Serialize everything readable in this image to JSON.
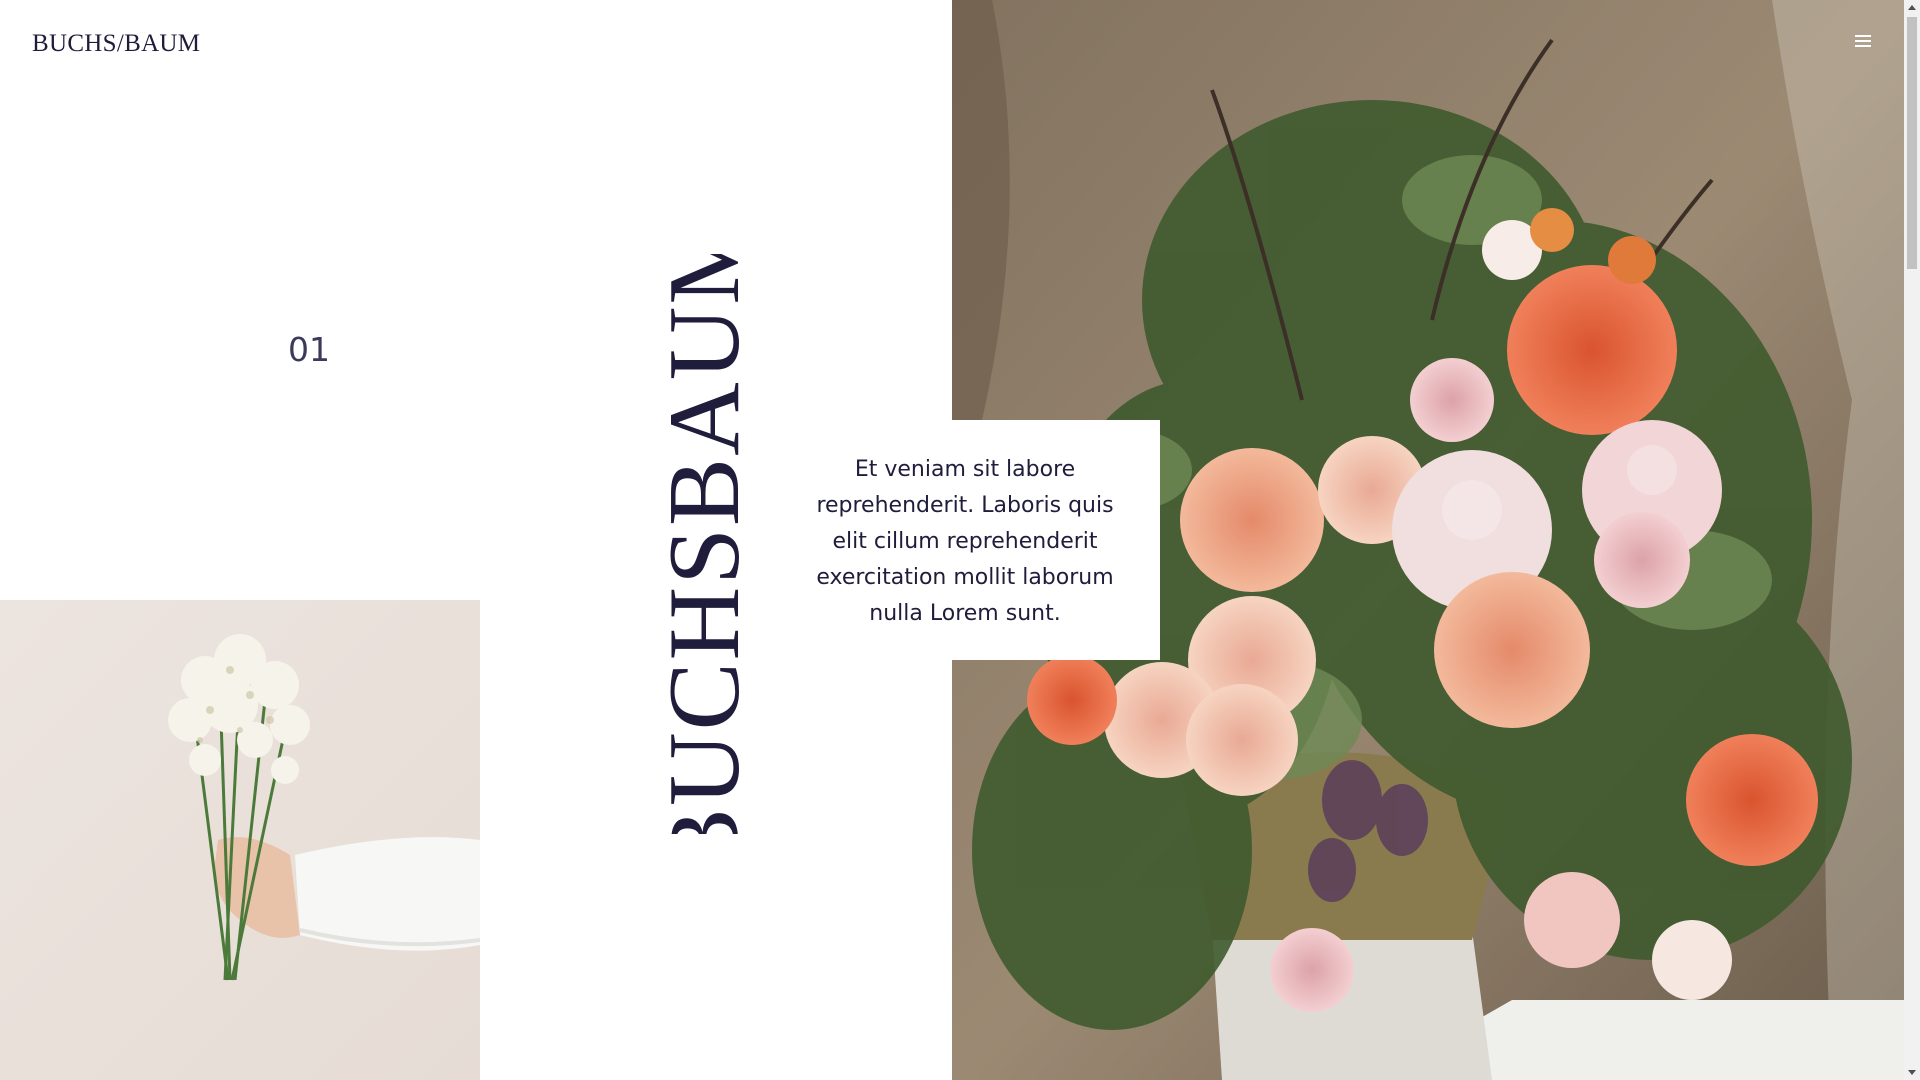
{
  "header": {
    "logo": "BUCHS/BAUM",
    "menu_icon": "hamburger-menu-icon"
  },
  "slide": {
    "number": "01",
    "title": "BUCHSBAUM",
    "description": "Et veniam sit labore reprehenderit. Laboris quis elit cillum reprehenderit exercitation mollit laborum nulla Lorem sunt."
  },
  "images": {
    "left": "hand-holding-babys-breath-bouquet-photo",
    "right": "large-flower-arrangement-photo"
  },
  "colors": {
    "text_dark": "#1f1d3b",
    "background": "#ffffff",
    "scrollbar_track": "#f1f1f1",
    "scrollbar_thumb": "#c1c1c1"
  }
}
